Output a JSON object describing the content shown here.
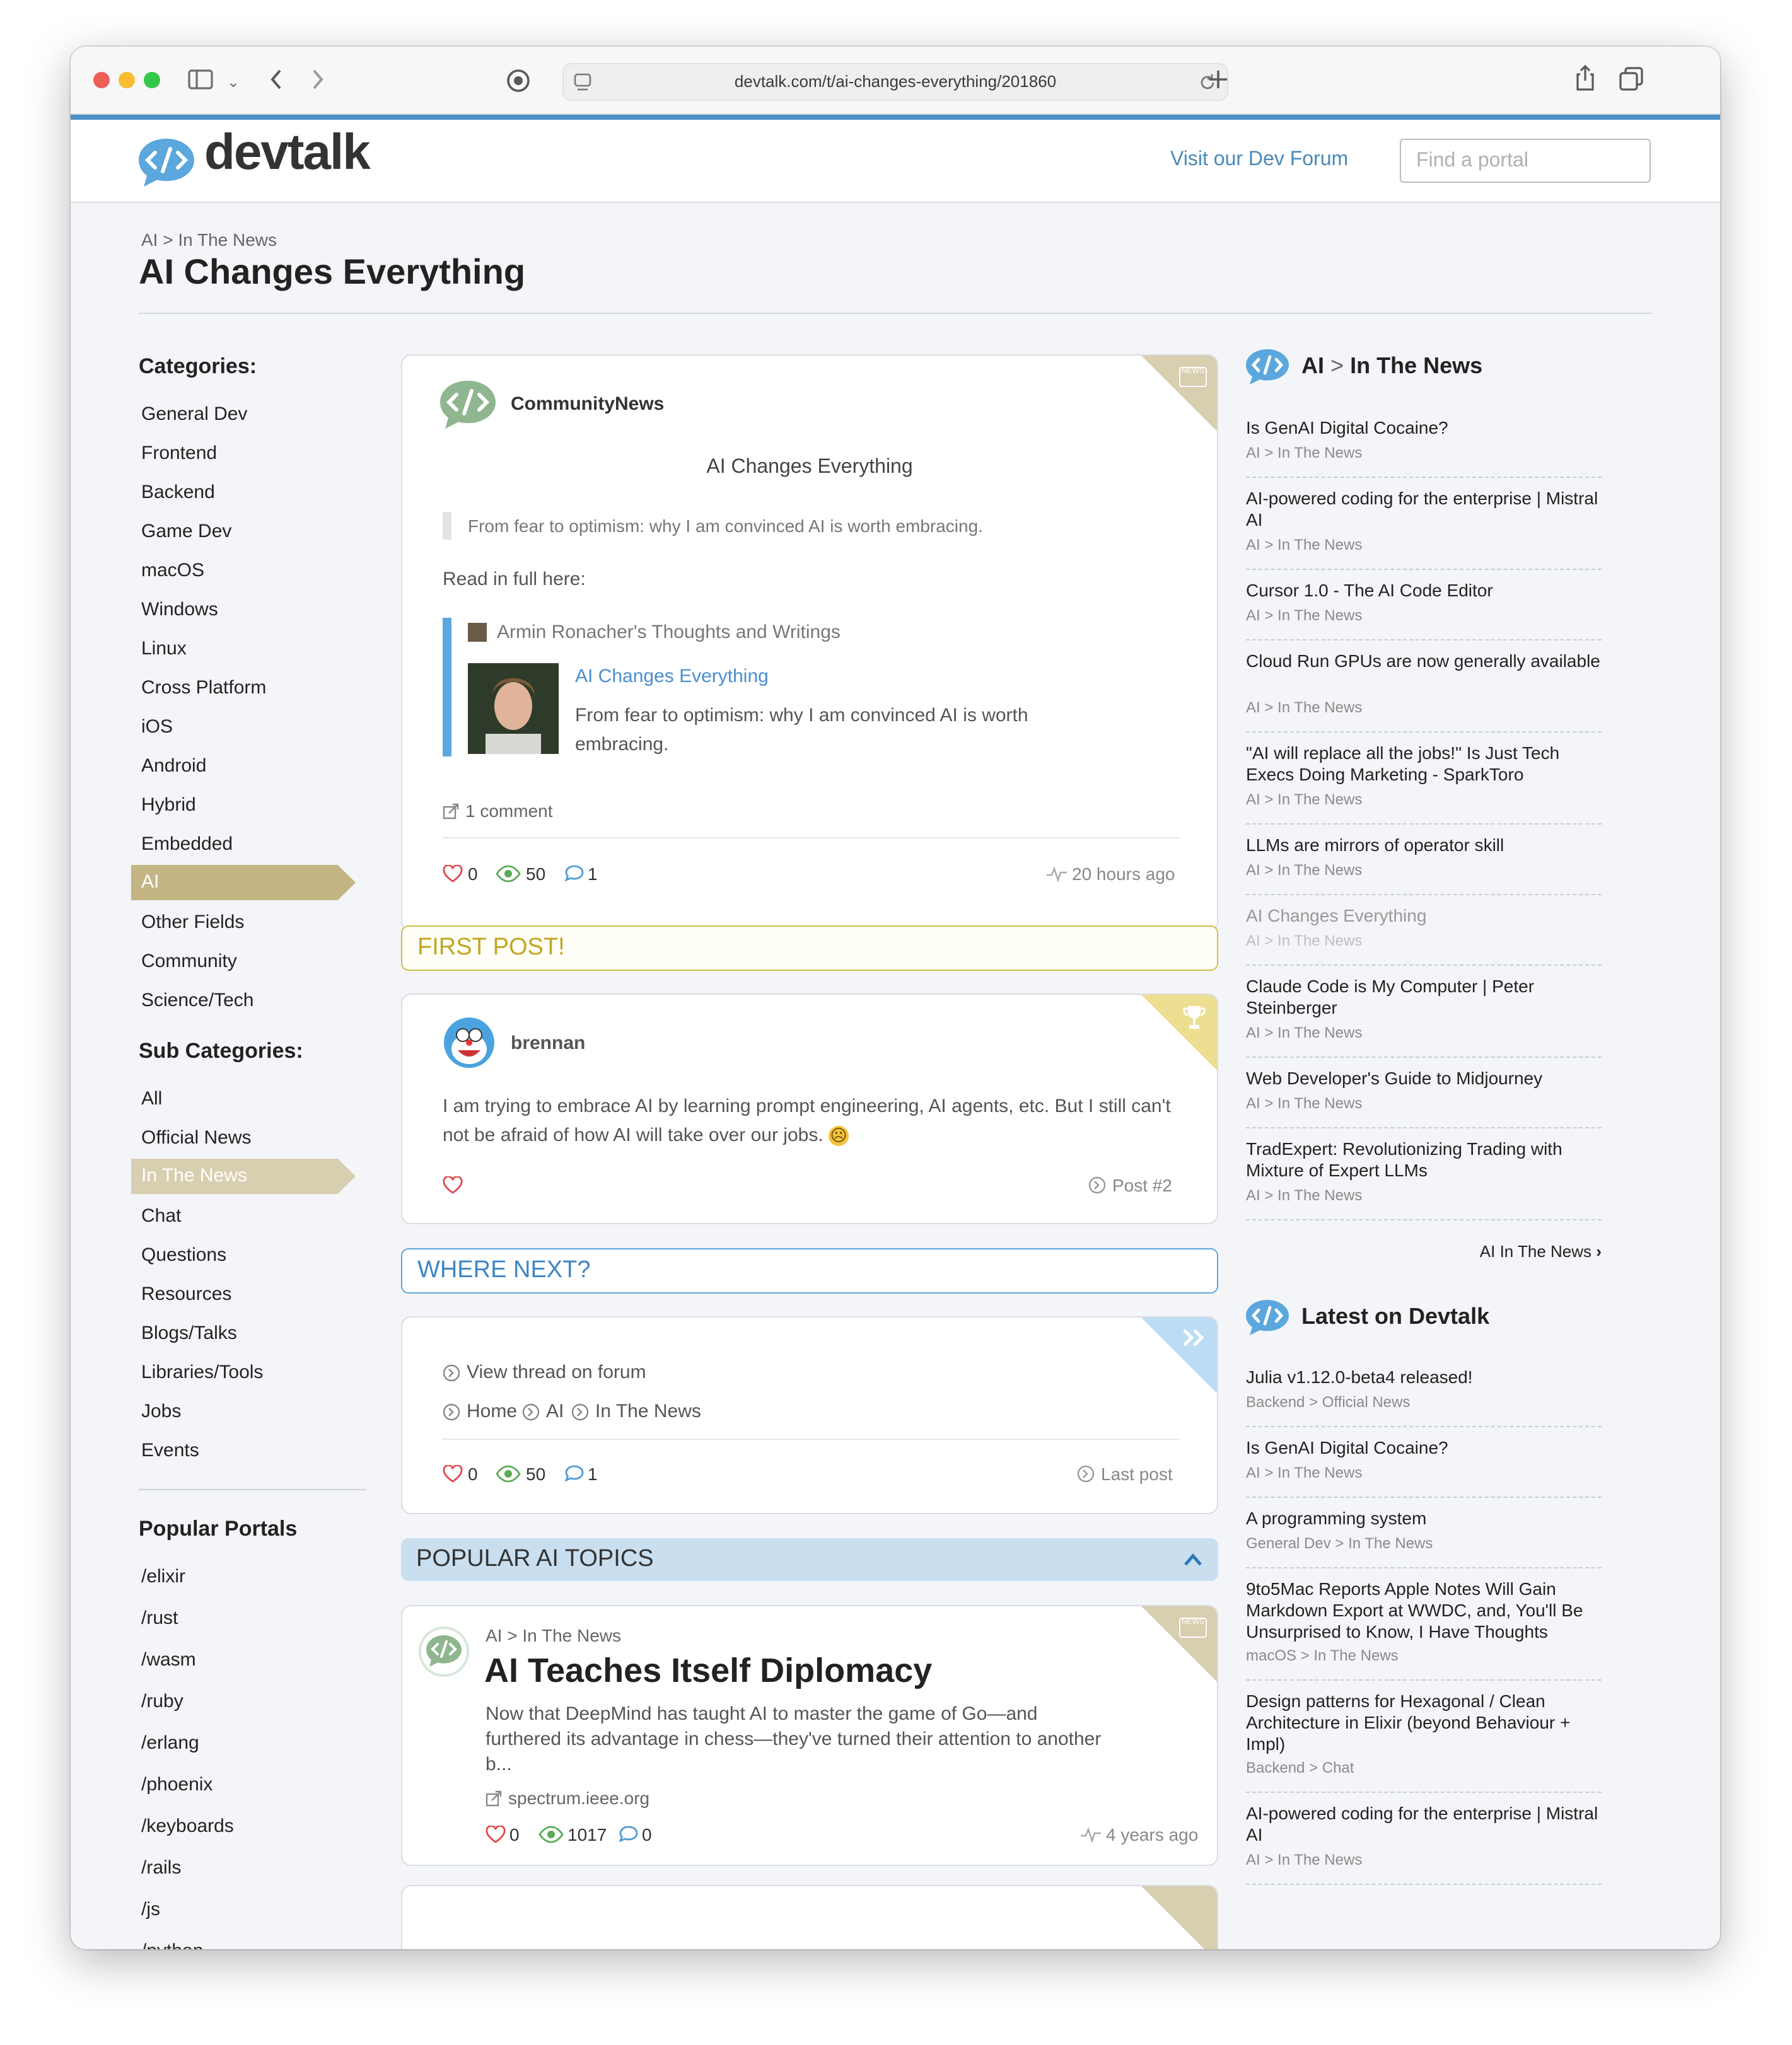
{
  "browser": {
    "url": "devtalk.com/t/ai-changes-everything/201860"
  },
  "header": {
    "logo_text": "devtalk",
    "forum_link": "Visit our Dev Forum",
    "portal_placeholder": "Find a portal"
  },
  "page": {
    "breadcrumb": "AI > In The News",
    "title": "AI Changes Everything"
  },
  "sidebar": {
    "categories_title": "Categories:",
    "categories": [
      "General Dev",
      "Frontend",
      "Backend",
      "Game Dev",
      "macOS",
      "Windows",
      "Linux",
      "Cross Platform",
      "iOS",
      "Android",
      "Hybrid",
      "Embedded",
      "AI",
      "Other Fields",
      "Community",
      "Science/Tech"
    ],
    "sub_title": "Sub Categories:",
    "subcategories": [
      "All",
      "Official News",
      "In The News",
      "Chat",
      "Questions",
      "Resources",
      "Blogs/Talks",
      "Libraries/Tools",
      "Jobs",
      "Events"
    ],
    "portals_title": "Popular Portals",
    "portals": [
      "/elixir",
      "/rust",
      "/wasm",
      "/ruby",
      "/erlang",
      "/phoenix",
      "/keyboards",
      "/rails",
      "/js",
      "/python"
    ],
    "active_color": "#c4b584",
    "active_sub_color": "#d8ceb0"
  },
  "post1": {
    "author": "CommunityNews",
    "heading": "AI Changes Everything",
    "quote": "From fear to optimism: why I am convinced AI is worth embracing.",
    "read_full": "Read in full here:",
    "onebox_site": "Armin Ronacher's Thoughts and Writings",
    "onebox_title": "AI Changes Everything",
    "onebox_desc": "From fear to optimism: why I am convinced AI is worth embracing.",
    "comments": "1 comment",
    "likes": "0",
    "views": "50",
    "replies": "1",
    "time": "20 hours ago",
    "badge": "NEWS"
  },
  "banner_first": "FIRST POST!",
  "post2": {
    "author": "brennan",
    "body": "I am trying to embrace AI by learning prompt engineering, AI agents, etc. But I still can't not be afraid of how AI will take over our jobs.",
    "emoji": "☹",
    "post_number": "Post #2"
  },
  "banner_next": "WHERE NEXT?",
  "where_next": {
    "view_thread": "View thread on forum",
    "nav": [
      "Home",
      "AI",
      "In The News"
    ],
    "likes": "0",
    "views": "50",
    "replies": "1",
    "last_post": "Last post"
  },
  "banner_popular": "POPULAR AI TOPICS",
  "topic": {
    "crumb": "AI > In The News",
    "title": "AI Teaches Itself Diplomacy",
    "desc": "Now that DeepMind has taught AI to master the game of Go—and furthered its advantage in chess—they've turned their attention to another b...",
    "source": "spectrum.ieee.org",
    "likes": "0",
    "views": "1017",
    "replies": "0",
    "time": "4 years ago"
  },
  "right_news": {
    "title_prefix": "AI",
    "title_suffix": "In The News",
    "items": [
      {
        "title": "Is GenAI Digital Cocaine?",
        "cat": "AI > In The News"
      },
      {
        "title": "AI-powered coding for the enterprise | Mistral AI",
        "cat": "AI > In The News"
      },
      {
        "title": "Cursor 1.0 - The AI Code Editor",
        "cat": "AI > In The News"
      },
      {
        "title": "Cloud Run GPUs are now generally available",
        "cat": "AI > In The News"
      },
      {
        "title": "\"AI will replace all the jobs!\" Is Just Tech Execs Doing Marketing - SparkToro",
        "cat": "AI > In The News"
      },
      {
        "title": "LLMs are mirrors of operator skill",
        "cat": "AI > In The News"
      },
      {
        "title": "AI Changes Everything",
        "cat": "AI > In The News"
      },
      {
        "title": "Claude Code is My Computer | Peter Steinberger",
        "cat": "AI > In The News"
      },
      {
        "title": "Web Developer's Guide to Midjourney",
        "cat": "AI > In The News"
      },
      {
        "title": "TradExpert: Revolutionizing Trading with Mixture of Expert LLMs",
        "cat": "AI > In The News"
      }
    ],
    "more": "AI In The News"
  },
  "right_latest": {
    "title": "Latest on Devtalk",
    "items": [
      {
        "title": "Julia v1.12.0-beta4 released!",
        "cat": "Backend > Official News"
      },
      {
        "title": "Is GenAI Digital Cocaine?",
        "cat": "AI > In The News"
      },
      {
        "title": "A programming system",
        "cat": "General Dev > In The News"
      },
      {
        "title": "9to5Mac Reports Apple Notes Will Gain Markdown Export at WWDC, and, You'll Be Unsurprised to Know, I Have Thoughts",
        "cat": "macOS > In The News"
      },
      {
        "title": "Design patterns for Hexagonal / Clean Architecture in Elixir (beyond Behaviour + Impl)",
        "cat": "Backend > Chat"
      },
      {
        "title": "AI-powered coding for the enterprise | Mistral AI",
        "cat": "AI > In The News"
      }
    ]
  }
}
